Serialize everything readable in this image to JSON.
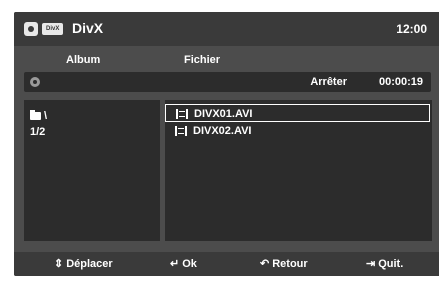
{
  "header": {
    "badge": "DivX",
    "title": "DivX",
    "time": "12:00"
  },
  "columns": {
    "album": "Album",
    "file": "Fichier"
  },
  "status": {
    "state": "Arrêter",
    "time": "00:00:19"
  },
  "album": {
    "path": "\\",
    "page": "1/2"
  },
  "files": [
    {
      "name": "DIVX01.AVI",
      "selected": true
    },
    {
      "name": "DIVX02.AVI",
      "selected": false
    }
  ],
  "footer": {
    "move_icon": "⇕",
    "move_label": "Déplacer",
    "ok_icon": "↵",
    "ok_label": "Ok",
    "return_icon": "↶",
    "return_label": "Retour",
    "quit_icon": "⇥",
    "quit_label": "Quit."
  }
}
